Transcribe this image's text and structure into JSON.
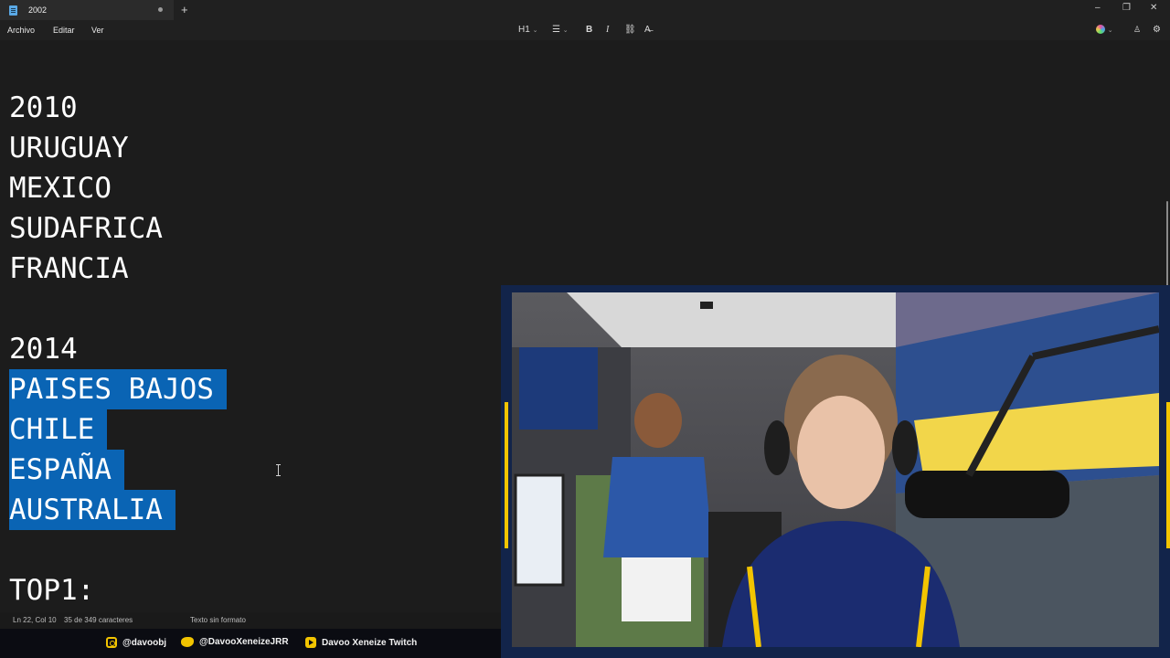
{
  "window": {
    "tab_title": "2002",
    "new_tab": "+",
    "controls": {
      "minimize": "–",
      "maximize": "❐",
      "close": "✕"
    }
  },
  "menu": [
    "Archivo",
    "Editar",
    "Ver"
  ],
  "toolbar": {
    "heading": "H1",
    "list": "☰",
    "bold": "B",
    "italic": "I",
    "link": "⛓",
    "clear_format": "A̶"
  },
  "editor": {
    "lines": [
      {
        "text": "2010",
        "selected": false
      },
      {
        "text": "URUGUAY",
        "selected": false
      },
      {
        "text": "MEXICO",
        "selected": false
      },
      {
        "text": "SUDAFRICA",
        "selected": false
      },
      {
        "text": "FRANCIA",
        "selected": false
      },
      {
        "text": "",
        "selected": false
      },
      {
        "text": "2014",
        "selected": false
      },
      {
        "text": "PAISES BAJOS",
        "selected": true
      },
      {
        "text": "CHILE",
        "selected": true
      },
      {
        "text": "ESPAÑA",
        "selected": true
      },
      {
        "text": "AUSTRALIA",
        "selected": true
      },
      {
        "text": "",
        "selected": false
      },
      {
        "text": "TOP1:",
        "selected": false
      }
    ]
  },
  "status": {
    "position": "Ln 22, Col 10",
    "chars": "35 de 349 caracteres",
    "format": "Texto sin formato"
  },
  "social": {
    "instagram": "@davoobj",
    "twitter": "@DavooXeneizeJRR",
    "twitch": "Davoo Xeneize Twitch"
  },
  "colors": {
    "selection": "#0a64b4",
    "accent_yellow": "#f2c400",
    "frame_blue": "#12244a"
  }
}
